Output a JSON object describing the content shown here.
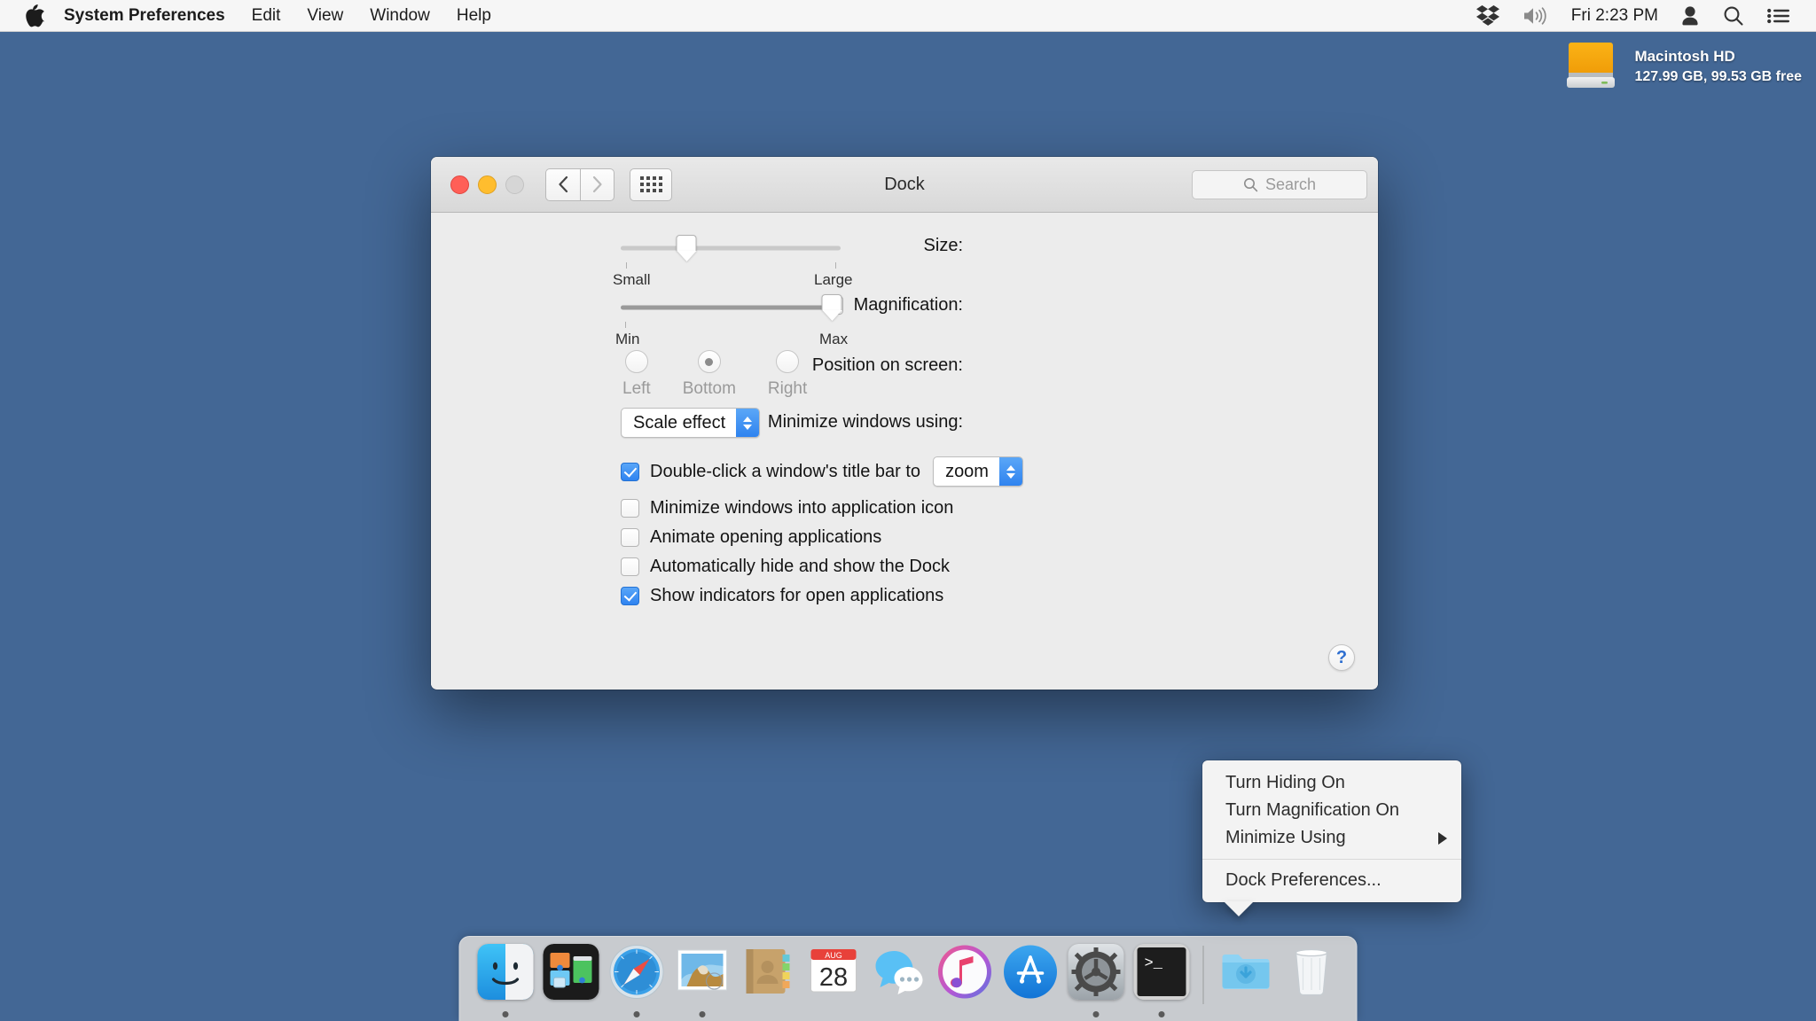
{
  "menubar": {
    "apple_icon": "apple-logo-icon",
    "items": [
      {
        "label": "System Preferences",
        "bold": true
      },
      {
        "label": "Edit",
        "bold": false
      },
      {
        "label": "View",
        "bold": false
      },
      {
        "label": "Window",
        "bold": false
      },
      {
        "label": "Help",
        "bold": false
      }
    ],
    "status_icons": [
      "dropbox-icon",
      "volume-icon"
    ],
    "clock": "Fri 2:23 PM",
    "right_icons": [
      "user-icon",
      "spotlight-search-icon",
      "notification-center-icon"
    ]
  },
  "desktop": {
    "background_color": "#436795",
    "drive": {
      "icon": "hard-drive-icon",
      "name": "Macintosh HD",
      "capacity": "127.99 GB, 99.53 GB free"
    }
  },
  "window": {
    "title": "Dock",
    "traffic_lights": {
      "close": "#ff5f57",
      "minimize": "#ffbd2e",
      "zoom": "#d6d6d6"
    },
    "toolbar": {
      "back_icon": "chevron-left-icon",
      "forward_icon": "chevron-right-icon",
      "show_all_icon": "grid-icon",
      "search_placeholder": "Search",
      "search_value": "",
      "search_icon": "magnifier-icon"
    },
    "help_button": "?",
    "controls": {
      "size": {
        "label": "Size:",
        "min_tick_label": "Small",
        "max_tick_label": "Large",
        "value_percent": 30
      },
      "magnification": {
        "label": "Magnification:",
        "checked": false,
        "min_tick_label": "Min",
        "max_tick_label": "Max",
        "value_percent": 96
      },
      "position": {
        "label": "Position on screen:",
        "options": [
          "Left",
          "Bottom",
          "Right"
        ],
        "selected": "Bottom"
      },
      "minimize_effect": {
        "label": "Minimize windows using:",
        "value": "Scale effect"
      },
      "double_click": {
        "label": "Double-click a window's title bar to",
        "checked": true,
        "action_value": "zoom"
      },
      "checkboxes": [
        {
          "label": "Minimize windows into application icon",
          "checked": false
        },
        {
          "label": "Animate opening applications",
          "checked": false
        },
        {
          "label": "Automatically hide and show the Dock",
          "checked": false
        },
        {
          "label": "Show indicators for open applications",
          "checked": true
        }
      ]
    }
  },
  "context_menu": {
    "items": [
      {
        "label": "Turn Hiding On",
        "submenu": false
      },
      {
        "label": "Turn Magnification On",
        "submenu": false
      },
      {
        "label": "Minimize Using",
        "submenu": true
      },
      {
        "separator_before": true,
        "label": "Dock Preferences...",
        "submenu": false
      }
    ]
  },
  "dock": {
    "apps": [
      {
        "name": "Finder",
        "icon": "finder-icon",
        "running": true
      },
      {
        "name": "Mission Control",
        "icon": "mission-control-icon",
        "running": false
      },
      {
        "name": "Safari",
        "icon": "safari-icon",
        "running": true
      },
      {
        "name": "Mail",
        "icon": "mail-icon",
        "running": true
      },
      {
        "name": "Contacts",
        "icon": "contacts-icon",
        "running": false
      },
      {
        "name": "Calendar",
        "icon": "calendar-icon",
        "running": false,
        "month": "AUG",
        "day": "28"
      },
      {
        "name": "Messages",
        "icon": "messages-icon",
        "running": false
      },
      {
        "name": "iTunes",
        "icon": "itunes-icon",
        "running": false
      },
      {
        "name": "App Store",
        "icon": "app-store-icon",
        "running": false
      },
      {
        "name": "System Preferences",
        "icon": "system-preferences-icon",
        "running": true
      },
      {
        "name": "Terminal",
        "icon": "terminal-icon",
        "running": true
      }
    ],
    "others": [
      {
        "name": "Downloads",
        "icon": "downloads-folder-icon"
      },
      {
        "name": "Trash",
        "icon": "trash-icon"
      }
    ]
  }
}
